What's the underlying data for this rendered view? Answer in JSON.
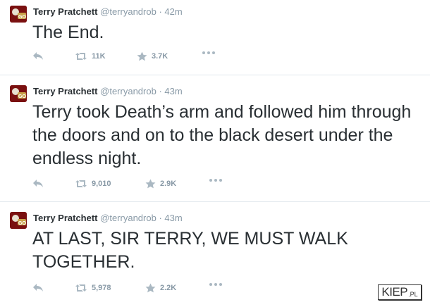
{
  "tweets": [
    {
      "author": "Terry Pratchett",
      "handle": "@terryandrob",
      "separator": "·",
      "time": "42m",
      "text": "The End.",
      "retweets": "11K",
      "favorites": "3.7K"
    },
    {
      "author": "Terry Pratchett",
      "handle": "@terryandrob",
      "separator": "·",
      "time": "43m",
      "text": "Terry took Death’s arm and followed him through the doors and on to the black desert under the endless night.",
      "retweets": "9,010",
      "favorites": "2.9K"
    },
    {
      "author": "Terry Pratchett",
      "handle": "@terryandrob",
      "separator": "·",
      "time": "43m",
      "text": "AT LAST, SIR TERRY, WE MUST WALK TOGETHER.",
      "retweets": "5,978",
      "favorites": "2.2K"
    }
  ],
  "watermark": {
    "main": "KIEP",
    "suffix": ".PL"
  },
  "colors": {
    "text": "#292f33",
    "muted": "#8899a6",
    "divider": "#e1e8ed"
  }
}
